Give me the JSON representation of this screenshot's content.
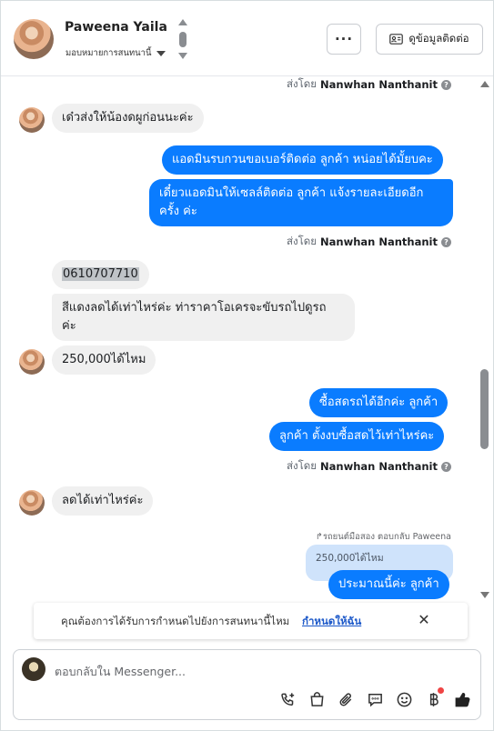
{
  "header": {
    "contact_name": "Paweena Yaila",
    "assign_label": "มอบหมายการสนทนานี้",
    "more_label": "···",
    "contact_info_label": "ดูข้อมูลติดต่อ"
  },
  "messages": {
    "sentby_prefix": "ส่งโดย",
    "sender_name": "Nanwhan Nanthanit",
    "help_glyph": "?",
    "in_1": "เด๋วส่งให้น้องดผูก่อนนะค่ะ",
    "out_1": "แอดมินรบกวนขอเบอร์ติดต่อ ลูกค้า หน่อยได้มั้ยบคะ",
    "out_2_line1": "เดี๋ยวแอดมินให้เซลล์ติดต่อ ลูกค้า แจ้งรายละเอียดอีก",
    "out_2_line2": "ครั้ง ค่ะ",
    "in_phone": "0610707710",
    "in_2_line1": "สีแดงลดได้เท่าไหร่ค่ะ ท่าราคาโอเครจะขับรถไปดูรถ",
    "in_2_line2": "ค่ะ",
    "in_3": "250,000ได้ไหม",
    "out_3": "ซื้อสดรถได้อีกค่ะ ลูกค้า",
    "out_4": "ลูกค้า ตั้งงบซื้อสดไว้เท่าไหร่คะ",
    "in_4": "ลดได้เท่าไหร่ค่ะ",
    "reply_note": "↱รถยนต์มือสอง ตอบกลับ Paweena",
    "quoted_text": "250,000ได้ไหม",
    "out_5": "ประมาณนี้ค่ะ ลูกค้า"
  },
  "banner": {
    "text": "คุณต้องการได้รับการกำหนดไปยังการสนทนานี้ไหม",
    "link": "กำหนดให้ฉัน",
    "close": "✕"
  },
  "composer": {
    "placeholder": "ตอบกลับใน Messenger..."
  },
  "colors": {
    "outgoing_bubble": "#0a7cff",
    "incoming_bubble": "#f0f0f0",
    "link": "#1d59c9",
    "notification_dot": "#ef4444"
  },
  "icons": [
    "call-icon",
    "shop-bag-icon",
    "attachment-icon",
    "saved-replies-icon",
    "emoji-icon",
    "baht-payment-icon",
    "thumbs-up-icon"
  ]
}
